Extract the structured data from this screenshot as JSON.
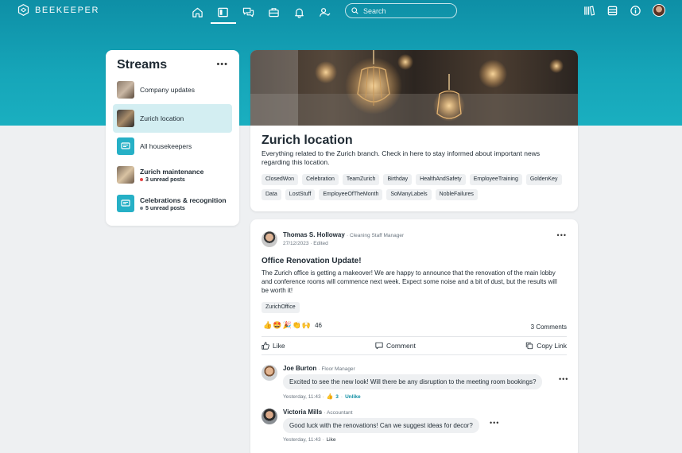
{
  "brand": {
    "name": "BEEKEEPER"
  },
  "nav": {
    "items": [
      {
        "icon": "home-icon"
      },
      {
        "icon": "streams-icon",
        "active": true
      },
      {
        "icon": "chat-icon"
      },
      {
        "icon": "tools-icon"
      },
      {
        "icon": "bell-icon"
      },
      {
        "icon": "people-icon"
      }
    ],
    "search_placeholder": "Search",
    "right_icons": [
      "library-icon",
      "inbox-icon",
      "info-icon",
      "profile-avatar"
    ]
  },
  "streams": {
    "title": "Streams",
    "more": "•••",
    "items": [
      {
        "name": "Company updates",
        "thumb": "photo"
      },
      {
        "name": "Zurich location",
        "thumb": "photo",
        "active": true
      },
      {
        "name": "All housekeepers",
        "thumb": "chat-icon"
      },
      {
        "name": "Zurich maintenance",
        "thumb": "photo",
        "unread": "3 unread posts",
        "dot_color": "#e64545"
      },
      {
        "name": "Celebrations & recognition",
        "thumb": "chat-icon",
        "unread": "5 unread posts",
        "dot_color": "#7d8790"
      }
    ]
  },
  "location": {
    "title": "Zurich location",
    "description": "Everything related to the Zurich branch. Check in here to stay informed about important news regarding this location.",
    "tags": [
      "ClosedWon",
      "Celebration",
      "TeamZurich",
      "Birthday",
      "HealthAndSafety",
      "EmployeeTraining",
      "GoldenKey",
      "Data",
      "LostStuff",
      "EmployeeOfTheMonth",
      "SoManyLabels",
      "NobleFailures"
    ]
  },
  "post": {
    "author": "Thomas S. Holloway",
    "role": "· Cleaning Staff Manager",
    "meta": "27/12/2023 · Edited",
    "more": "•••",
    "title": "Office Renovation Update!",
    "body": "The Zurich office is getting a makeover! We are happy to announce that the renovation of the main lobby and conference rooms will commence next week. Expect some noise and a bit of dust, but the results will be worth it!",
    "tag": "ZurichOffice",
    "reactions": [
      "👍",
      "🤩",
      "🎉",
      "👏",
      "🙌"
    ],
    "reaction_count": "46",
    "comments_count": "3 Comments",
    "actions": {
      "like": "Like",
      "comment": "Comment",
      "copy": "Copy Link"
    }
  },
  "comments": [
    {
      "author": "Joe Burton",
      "role": "· Floor Manager",
      "text": "Excited to see the new look! Will there be any disruption to the meeting room bookings?",
      "time": "Yesterday, 11:43 ·",
      "likes": "3",
      "action": "Unlike"
    },
    {
      "author": "Victoria Mills",
      "role": "· Accountant",
      "text": "Good luck with the renovations! Can we suggest ideas for decor?",
      "time": "Yesterday, 11:43 ·",
      "action": "Like"
    }
  ]
}
